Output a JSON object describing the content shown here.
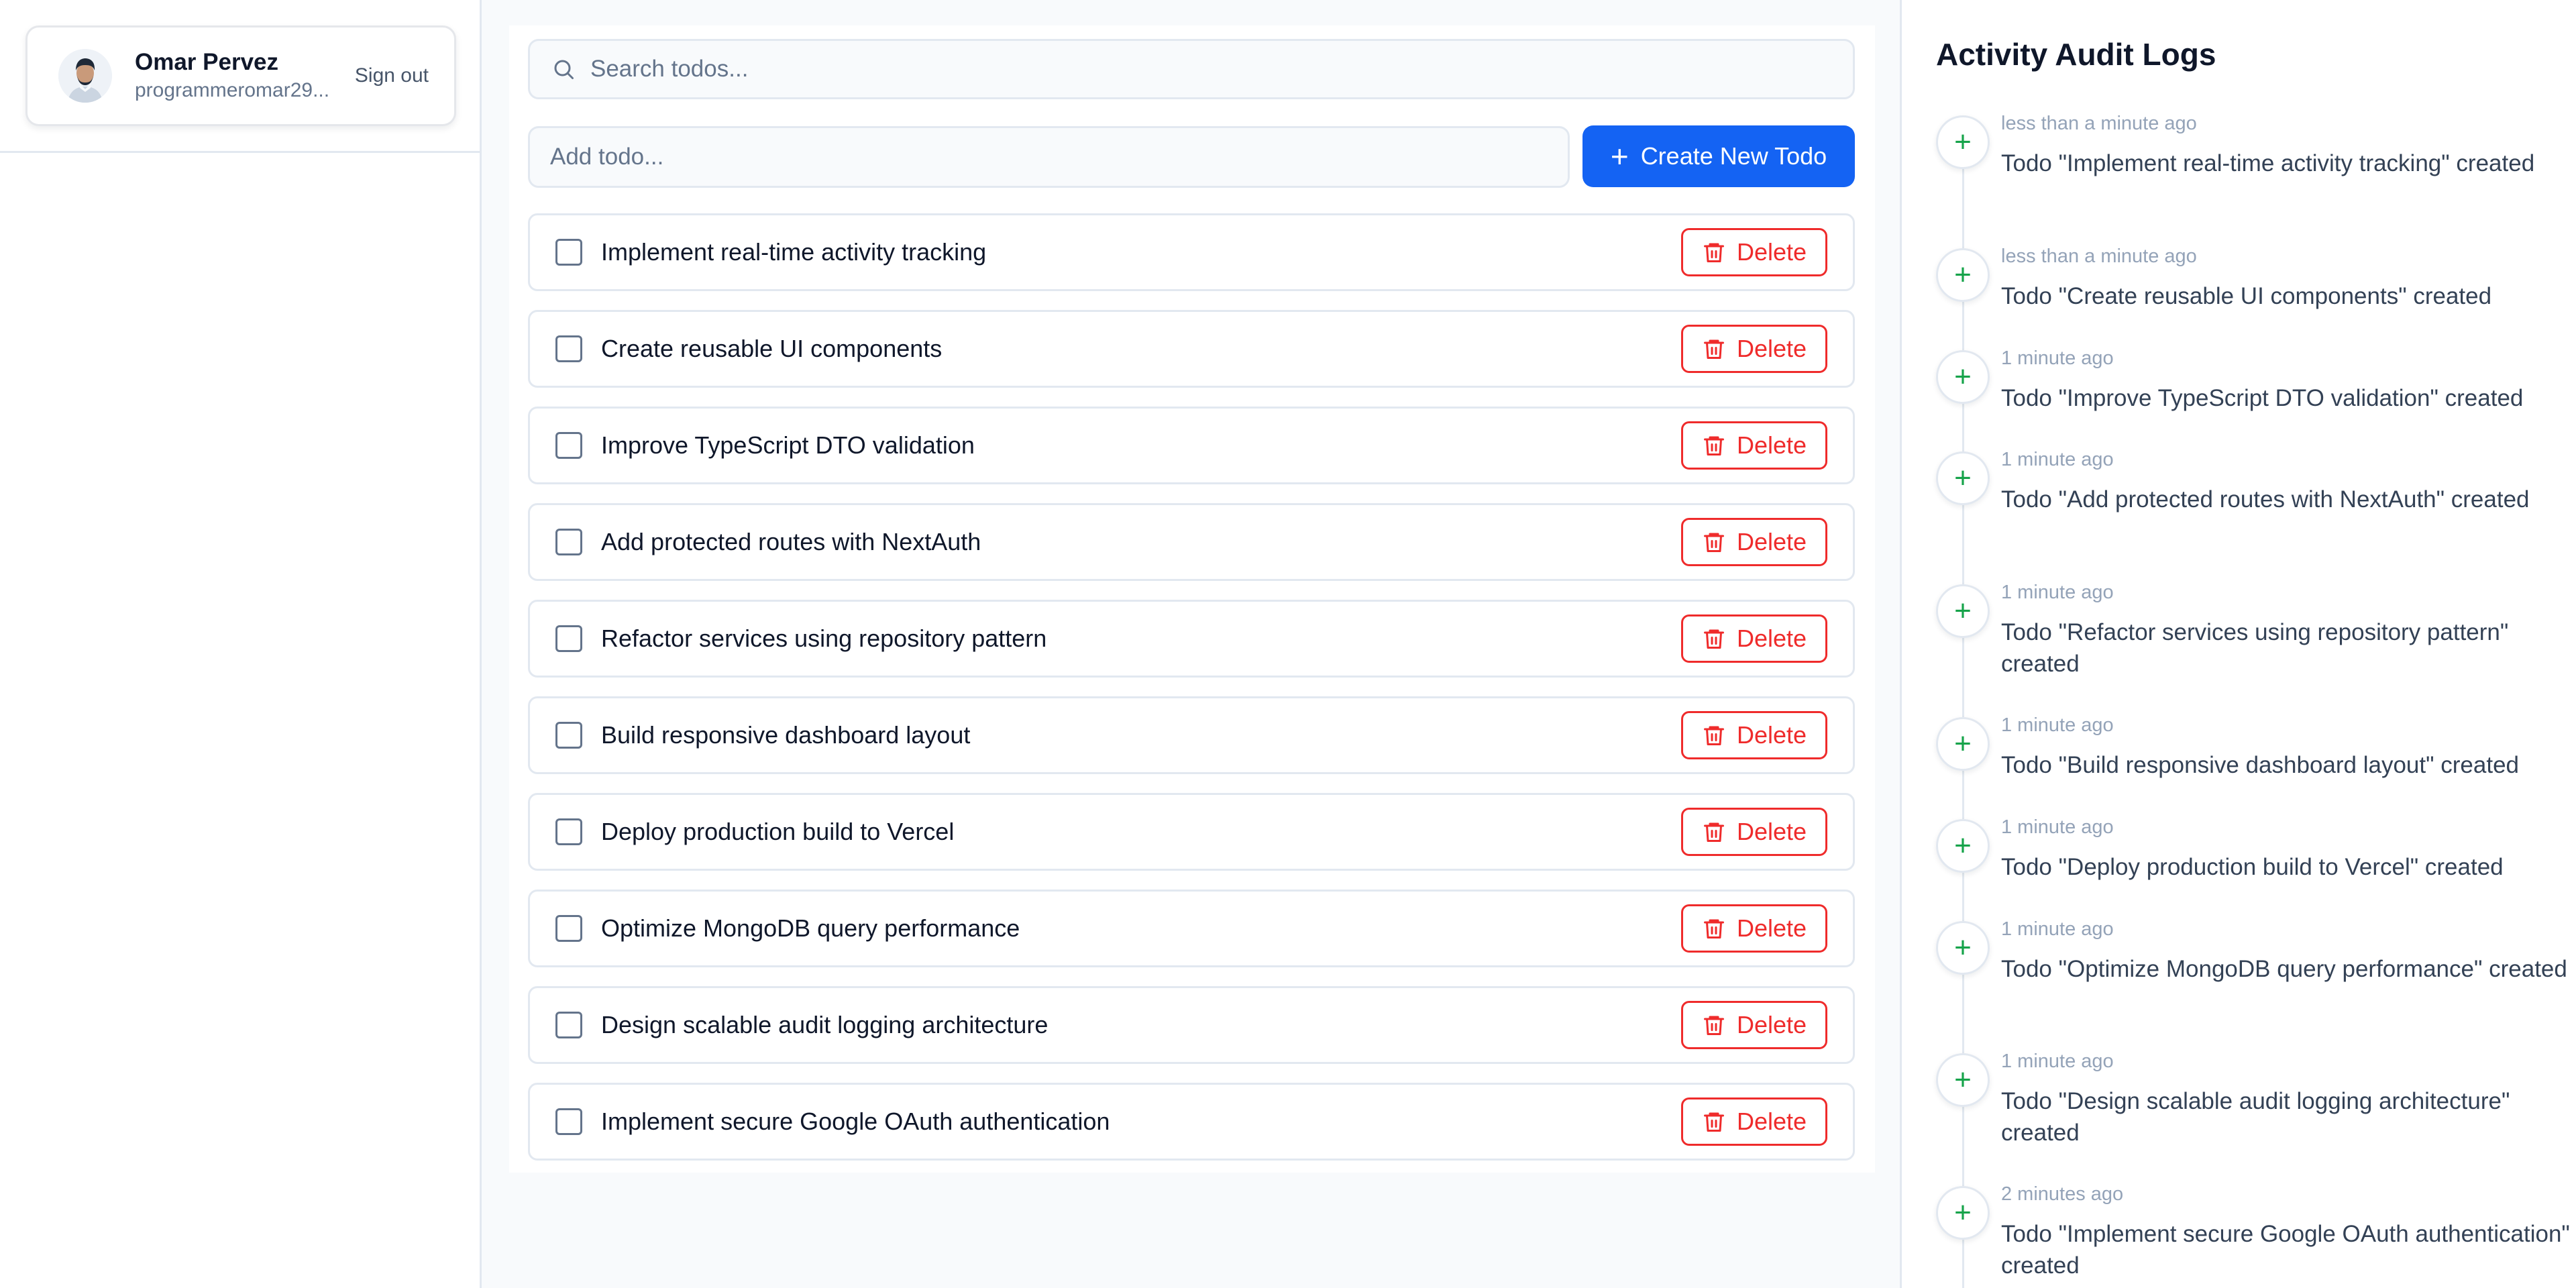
{
  "user": {
    "name": "Omar Pervez",
    "email": "programmeromar29...",
    "signout_label": "Sign out"
  },
  "search": {
    "placeholder": "Search todos..."
  },
  "add": {
    "placeholder": "Add todo...",
    "button_label": "Create New Todo"
  },
  "todos": [
    {
      "text": "Implement real-time activity tracking",
      "delete_label": "Delete"
    },
    {
      "text": "Create reusable UI components",
      "delete_label": "Delete"
    },
    {
      "text": "Improve TypeScript DTO validation",
      "delete_label": "Delete"
    },
    {
      "text": "Add protected routes with NextAuth",
      "delete_label": "Delete"
    },
    {
      "text": "Refactor services using repository pattern",
      "delete_label": "Delete"
    },
    {
      "text": "Build responsive dashboard layout",
      "delete_label": "Delete"
    },
    {
      "text": "Deploy production build to Vercel",
      "delete_label": "Delete"
    },
    {
      "text": "Optimize MongoDB query performance",
      "delete_label": "Delete"
    },
    {
      "text": "Design scalable audit logging architecture",
      "delete_label": "Delete"
    },
    {
      "text": "Implement secure Google OAuth authentication",
      "delete_label": "Delete"
    }
  ],
  "audit": {
    "title": "Activity Audit Logs",
    "logs": [
      {
        "time": "less than a minute ago",
        "text": "Todo \"Implement real-time activity tracking\" created"
      },
      {
        "time": "less than a minute ago",
        "text": "Todo \"Create reusable UI components\" created"
      },
      {
        "time": "1 minute ago",
        "text": "Todo \"Improve TypeScript DTO validation\" created"
      },
      {
        "time": "1 minute ago",
        "text": "Todo \"Add protected routes with NextAuth\" created"
      },
      {
        "time": "1 minute ago",
        "text": "Todo \"Refactor services using repository pattern\" created"
      },
      {
        "time": "1 minute ago",
        "text": "Todo \"Build responsive dashboard layout\" created"
      },
      {
        "time": "1 minute ago",
        "text": "Todo \"Deploy production build to Vercel\" created"
      },
      {
        "time": "1 minute ago",
        "text": "Todo \"Optimize MongoDB query performance\" created"
      },
      {
        "time": "1 minute ago",
        "text": "Todo \"Design scalable audit logging architecture\" created"
      },
      {
        "time": "2 minutes ago",
        "text": "Todo \"Implement secure Google OAuth authentication\" created"
      }
    ]
  },
  "colors": {
    "primary": "#1463f3",
    "danger": "#ef2b2b",
    "success": "#16a34a",
    "border": "#e2e8f0"
  },
  "icons": {
    "search": "search-icon",
    "plus": "plus-icon",
    "trash": "trash-icon",
    "avatar": "user-avatar"
  }
}
